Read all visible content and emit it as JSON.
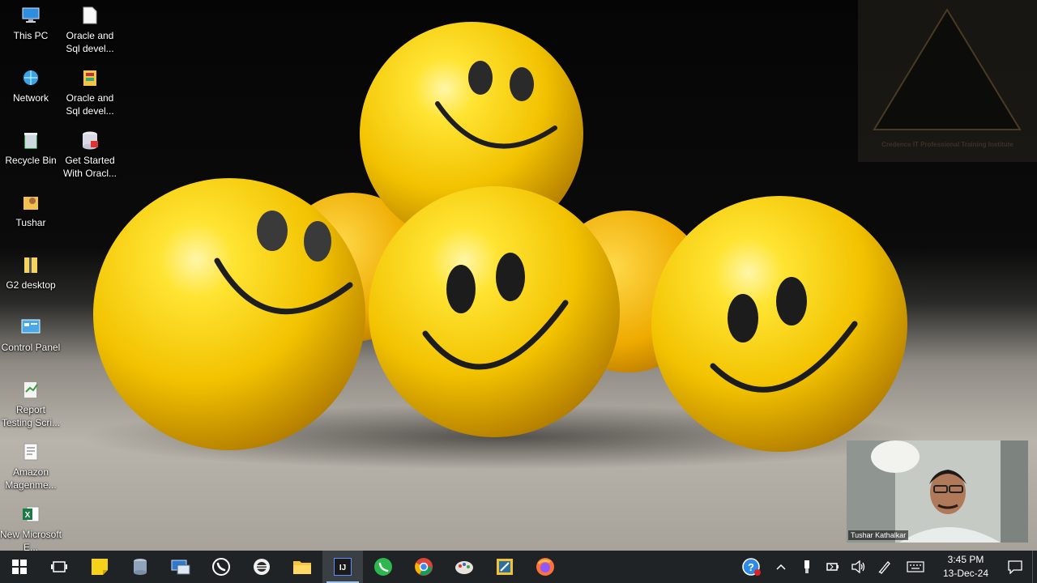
{
  "desktop": {
    "icons_left": [
      {
        "label": "This PC",
        "icon": "computer-icon"
      },
      {
        "label": "Network",
        "icon": "network-icon"
      },
      {
        "label": "Recycle Bin",
        "icon": "recycle-bin-icon"
      },
      {
        "label": "Tushar",
        "icon": "user-folder-icon"
      },
      {
        "label": "G2 desktop",
        "icon": "zip-folder-icon"
      },
      {
        "label": "Control Panel",
        "icon": "control-panel-icon"
      },
      {
        "label": "Report Testing Scri...",
        "icon": "script-icon"
      },
      {
        "label": "Amazon Magenme...",
        "icon": "document-icon"
      },
      {
        "label": "New Microsoft E...",
        "icon": "excel-icon"
      }
    ],
    "icons_right": [
      {
        "label": "Oracle and Sql devel...",
        "icon": "file-icon"
      },
      {
        "label": "Oracle and Sql devel...",
        "icon": "archive-icon"
      },
      {
        "label": "Get Started With Oracl...",
        "icon": "database-icon"
      }
    ]
  },
  "watermark": {
    "text": "Credence IT Professional Training Institute"
  },
  "webcam": {
    "name": "Tushar Kathalkar"
  },
  "taskbar": {
    "apps": [
      {
        "name": "start-button",
        "icon": "windows-logo-icon"
      },
      {
        "name": "task-view-button",
        "icon": "task-view-icon"
      },
      {
        "name": "taskbar-sticky-notes",
        "icon": "sticky-notes-icon"
      },
      {
        "name": "taskbar-database-tool",
        "icon": "database-tool-icon"
      },
      {
        "name": "taskbar-remote-desktop",
        "icon": "remote-desktop-icon"
      },
      {
        "name": "taskbar-whatsapp",
        "icon": "whatsapp-icon"
      },
      {
        "name": "taskbar-eclipse",
        "icon": "eclipse-icon"
      },
      {
        "name": "taskbar-file-explorer",
        "icon": "folder-icon"
      },
      {
        "name": "taskbar-intellij",
        "icon": "intellij-icon",
        "active": true
      },
      {
        "name": "taskbar-whatsapp-2",
        "icon": "whatsapp-icon"
      },
      {
        "name": "taskbar-chrome",
        "icon": "chrome-icon"
      },
      {
        "name": "taskbar-paint",
        "icon": "paint-icon"
      },
      {
        "name": "taskbar-sql-developer",
        "icon": "sql-developer-icon"
      },
      {
        "name": "taskbar-firefox",
        "icon": "firefox-icon"
      }
    ],
    "clock": {
      "time": "3:45 PM",
      "date": "13-Dec-24"
    }
  }
}
